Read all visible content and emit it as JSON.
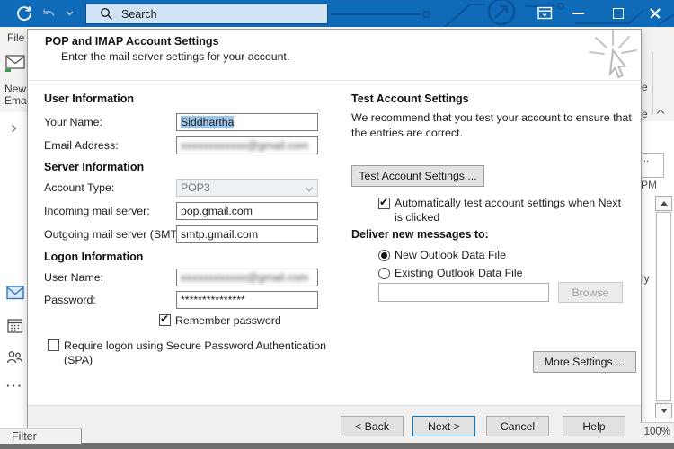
{
  "colors": {
    "titlebar": "#0f6ab8",
    "accent": "#0078d7",
    "selection": "#9cc7ea"
  },
  "titlebar": {
    "search_placeholder": "Search"
  },
  "background": {
    "file_tab": "File",
    "new_email_line1": "New",
    "new_email_line2": "Email",
    "nav_more": "···",
    "status_filter": "Filter",
    "status_zoom": "100%",
    "ribbon_cut_text_1": "e",
    "ribbon_cut_text_2": "e",
    "avatar_dots": "..",
    "list_time": "PM",
    "list_cut_text": "ly"
  },
  "dialog": {
    "title": "POP and IMAP Account Settings",
    "subtitle": "Enter the mail server settings for your account.",
    "user_info": {
      "heading": "User Information",
      "your_name_label": "Your Name:",
      "your_name_value": "Siddhartha",
      "email_label": "Email Address:",
      "email_value_blurred": "xxxxxxxxxxxx@gmail.com"
    },
    "server_info": {
      "heading": "Server Information",
      "account_type_label": "Account Type:",
      "account_type_value": "POP3",
      "incoming_label": "Incoming mail server:",
      "incoming_value": "pop.gmail.com",
      "outgoing_label": "Outgoing mail server (SMTP):",
      "outgoing_value": "smtp.gmail.com"
    },
    "logon_info": {
      "heading": "Logon Information",
      "username_label": "User Name:",
      "username_value_blurred": "xxxxxxxxxxxx@gmail.com",
      "password_label": "Password:",
      "password_value": "***************",
      "remember_password_label": "Remember password",
      "spa_label": "Require logon using Secure Password Authentication (SPA)"
    },
    "test_settings": {
      "heading": "Test Account Settings",
      "description": "We recommend that you test your account to ensure that the entries are correct.",
      "test_button_label": "Test Account Settings ...",
      "auto_test_label": "Automatically test account settings when Next is clicked"
    },
    "deliver": {
      "heading": "Deliver new messages to:",
      "option_new": "New Outlook Data File",
      "option_existing": "Existing Outlook Data File",
      "path_value": "",
      "browse_button_label": "Browse"
    },
    "more_settings_label": "More Settings ...",
    "buttons": {
      "back": "< Back",
      "next": "Next >",
      "cancel": "Cancel",
      "help": "Help"
    }
  }
}
